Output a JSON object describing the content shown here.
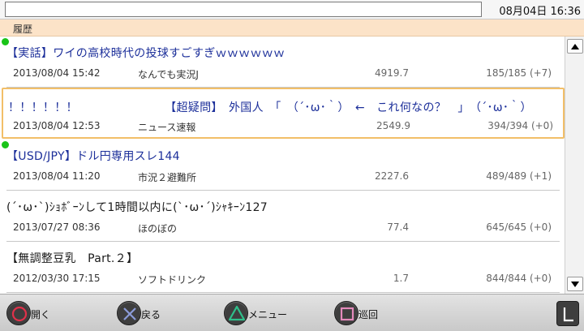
{
  "topbar": {
    "url_value": "",
    "datetime": "08月04日 16:36"
  },
  "section": {
    "title": "履歴"
  },
  "threads": [
    {
      "title": "【実話】ワイの高校時代の投球すごすぎｗｗｗｗｗｗ",
      "date": "2013/08/04 15:42",
      "board": "なんでも実況J",
      "speed": "4919.7",
      "count": "185/185 (+7)",
      "new": true,
      "selected": false,
      "title_color": "#1c2f9a"
    },
    {
      "title": "！！！！！！　　　　　　　　【超疑問】　外国人　「　（´･ω･｀）　←　これ何なの？　」　（´･ω･｀）",
      "date": "2013/08/04 12:53",
      "board": "ニュース速報",
      "speed": "2549.9",
      "count": "394/394 (+0)",
      "new": false,
      "selected": true,
      "title_color": "#1c2f9a"
    },
    {
      "title": "【USD/JPY】ドル円専用スレ144",
      "date": "2013/08/04 11:20",
      "board": "市況２避難所",
      "speed": "2227.6",
      "count": "489/489 (+1)",
      "new": true,
      "selected": false,
      "title_color": "#1c2f9a"
    },
    {
      "title": "(´･ω･`)ｼｮﾎﾞｰﾝして1時間以内に(`･ω･´)ｼｬｷｰﾝ127",
      "date": "2013/07/27 08:36",
      "board": "ほのぼの",
      "speed": "77.4",
      "count": "645/645 (+0)",
      "new": false,
      "selected": false,
      "title_color": "#1a1a1a"
    },
    {
      "title": "【無調整豆乳　Part.２】",
      "date": "2012/03/30 17:15",
      "board": "ソフトドリンク",
      "speed": "1.7",
      "count": "844/844 (+0)",
      "new": false,
      "selected": false,
      "title_color": "#1a1a1a"
    }
  ],
  "controls": {
    "open_label": "開く",
    "back_label": "戻る",
    "menu_label": "メニュー",
    "patrol_label": "巡回",
    "open_icon": "circle-button-icon",
    "back_icon": "cross-button-icon",
    "menu_icon": "triangle-button-icon",
    "patrol_icon": "square-button-icon",
    "l_icon": "l-button-icon"
  },
  "colors": {
    "circle": "#e0314a",
    "cross": "#8b9bd8",
    "triangle": "#2fbf8a",
    "square": "#e48abc",
    "new_dot": "#19c418",
    "selected_border": "#f2bf68",
    "header_bg": "#fce3c8"
  }
}
